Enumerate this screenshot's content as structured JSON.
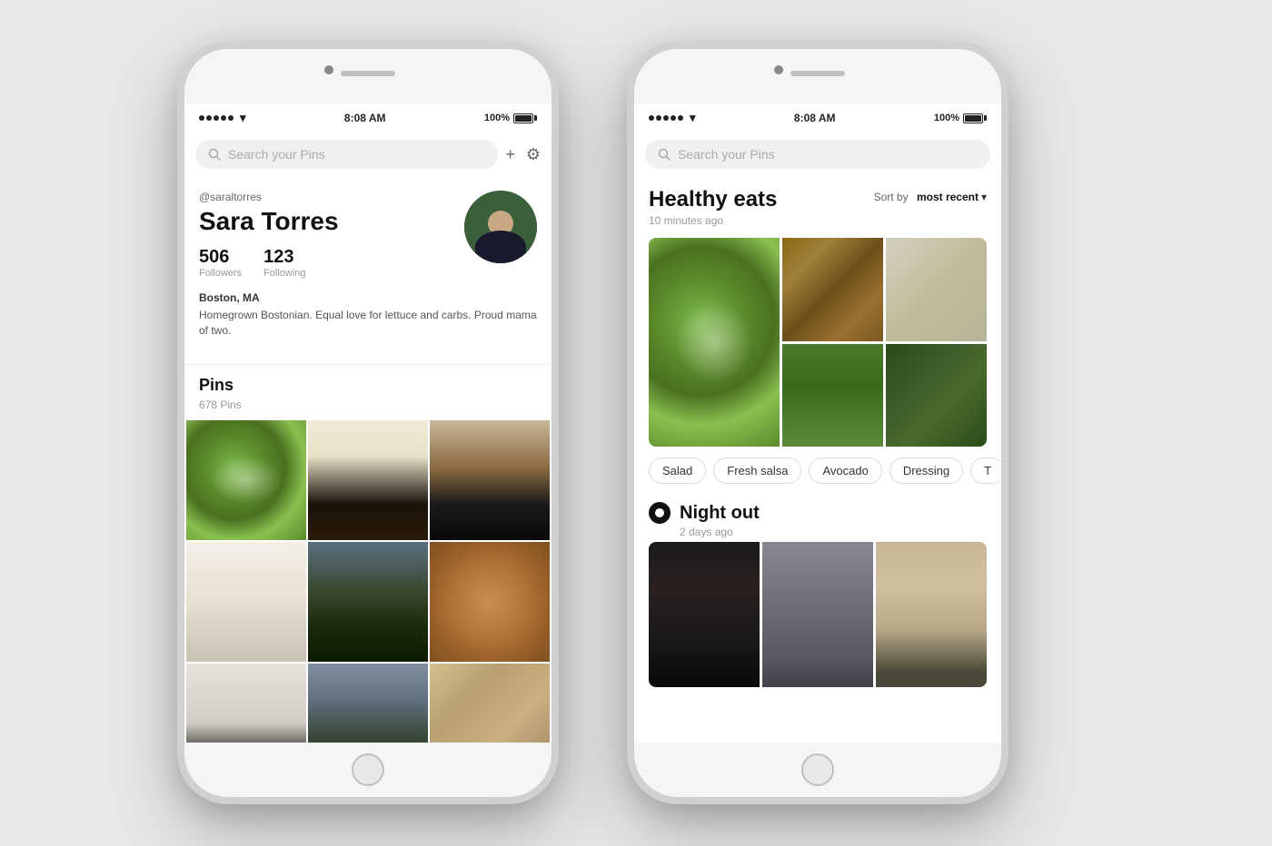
{
  "background": "#e8e8e8",
  "phones": {
    "left": {
      "status_bar": {
        "time": "8:08 AM",
        "battery": "100%",
        "signal": "●●●●●",
        "wifi": "WiFi"
      },
      "search": {
        "placeholder": "Search your Pins"
      },
      "header_icons": {
        "add": "+",
        "settings": "⚙"
      },
      "profile": {
        "handle": "@saraltorres",
        "name": "Sara Torres",
        "followers_count": "506",
        "followers_label": "Followers",
        "following_count": "123",
        "following_label": "Following",
        "location": "Boston, MA",
        "bio": "Homegrown Bostonian. Equal love for lettuce and carbs. Proud mama of two."
      },
      "pins_section": {
        "title": "Pins",
        "count": "678 Pins"
      }
    },
    "right": {
      "status_bar": {
        "time": "8:08 AM",
        "battery": "100%",
        "signal": "●●●●●",
        "wifi": "WiFi"
      },
      "search": {
        "placeholder": "Search your Pins"
      },
      "boards": [
        {
          "title": "Healthy eats",
          "timestamp": "10 minutes ago",
          "sort_label": "Sort by",
          "sort_value": "most recent",
          "tags": [
            "Salad",
            "Fresh salsa",
            "Avocado",
            "Dressing",
            "T"
          ]
        },
        {
          "title": "Night out",
          "timestamp": "2 days ago",
          "has_icon": true
        }
      ]
    }
  }
}
